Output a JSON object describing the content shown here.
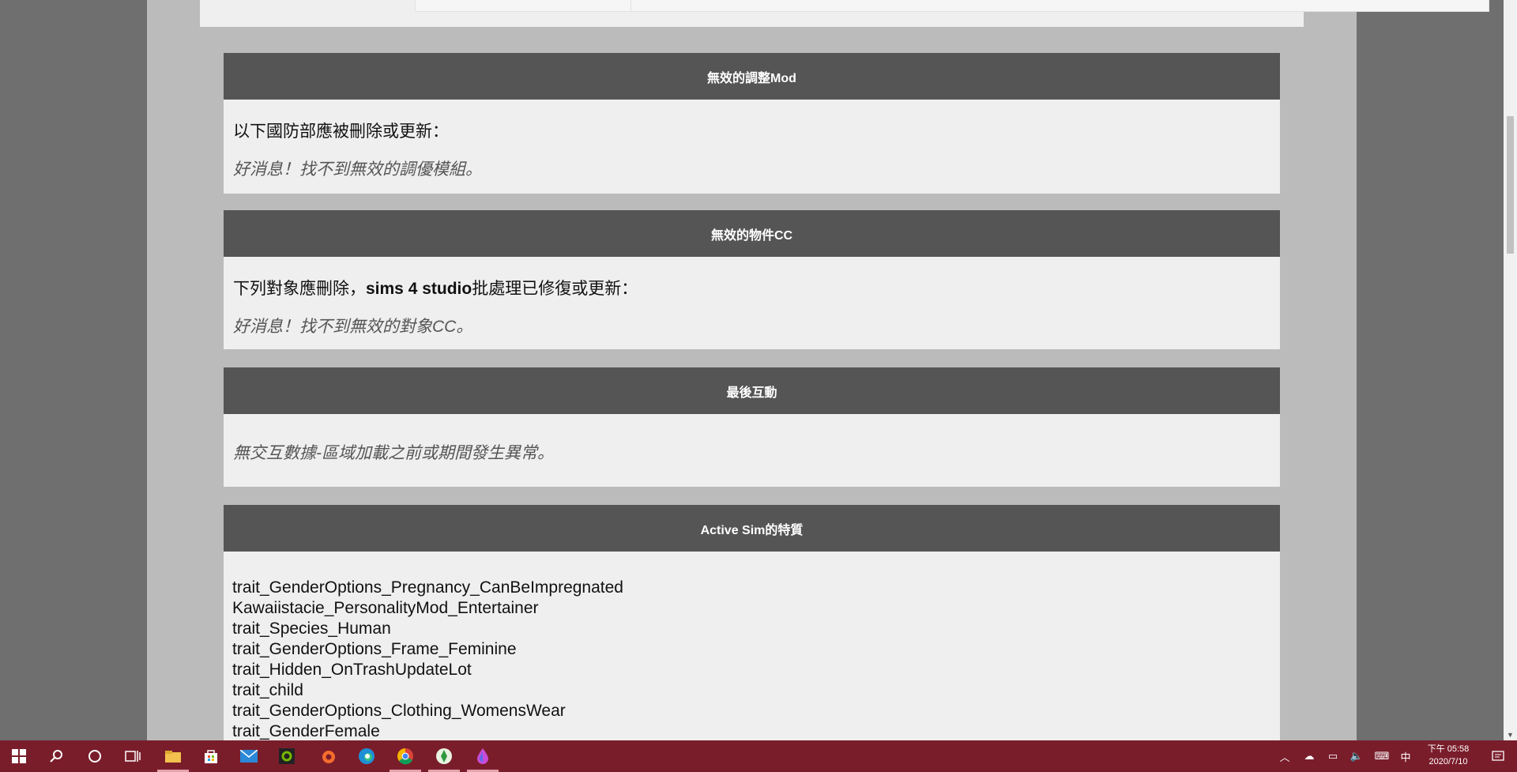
{
  "sections": [
    {
      "title": "無效的調整Mod",
      "intro": "以下國防部應被刪除或更新：",
      "result": "好消息！找不到無效的調優模組。"
    },
    {
      "title": "無效的物件CC",
      "intro_prefix": "下列對象應刪除，",
      "intro_bold": "sims 4 studio",
      "intro_suffix": "批處理已修復或更新：",
      "result": "好消息！找不到無效的對象CC。"
    },
    {
      "title": "最後互動",
      "result": "無交互數據-區域加載之前或期間發生異常。"
    },
    {
      "title": "Active Sim的特質",
      "traits": [
        "trait_GenderOptions_Pregnancy_CanBeImpregnated",
        "Kawaiistacie_PersonalityMod_Entertainer",
        "trait_Species_Human",
        "trait_GenderOptions_Frame_Feminine",
        "trait_Hidden_OnTrashUpdateLot",
        "trait_child",
        "trait_GenderOptions_Clothing_WomensWear",
        "trait_GenderFemale"
      ]
    }
  ],
  "taskbar": {
    "apps": [
      "start-icon",
      "search-icon",
      "cortana-icon",
      "task-view-icon",
      "file-explorer-icon",
      "store-icon",
      "mail-icon",
      "nvidia-icon",
      "origin-icon",
      "edge-icon",
      "chrome-icon",
      "sims-icon",
      "droplet-app-icon"
    ],
    "tray": {
      "ime": "中",
      "time": "下午 05:58",
      "date": "2020/7/10"
    }
  }
}
